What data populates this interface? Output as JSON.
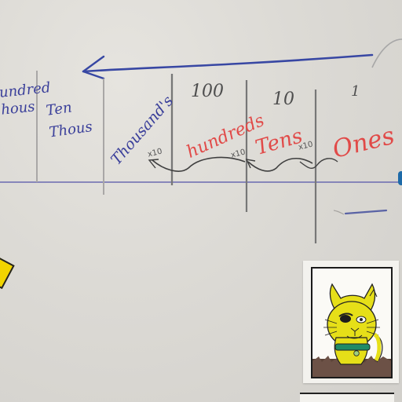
{
  "board": {
    "columns": [
      {
        "id": "hundred-thousands",
        "label": "undred\nhous"
      },
      {
        "id": "ten-thousands",
        "label": "Ten\nThous"
      },
      {
        "id": "thousands",
        "label": "Thousand's",
        "factor": "x10"
      },
      {
        "id": "hundreds",
        "number": "100",
        "label": "hundreds",
        "factor": "x10"
      },
      {
        "id": "tens",
        "number": "10",
        "label": "Tens",
        "factor": "x10"
      },
      {
        "id": "ones",
        "number": "1",
        "label": "Ones"
      }
    ]
  },
  "colors": {
    "board": "#d9d7d2",
    "marker_blue": "#3a3f9a",
    "marker_red": "#e14a48",
    "cat_yellow": "#e8e21d",
    "card": "#f3f2ee"
  },
  "icons": {
    "arrow": "left-arrow-icon",
    "cat": "cat-drawing-icon",
    "sticky_note": "yellow-note-icon"
  }
}
